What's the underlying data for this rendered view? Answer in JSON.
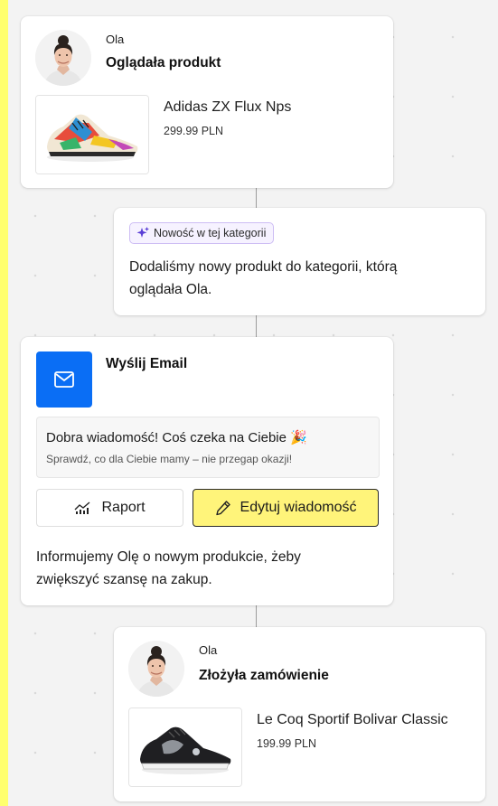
{
  "timeline": {
    "viewed": {
      "user_name": "Ola",
      "action": "Oglądała produkt",
      "product_name": "Adidas ZX Flux Nps",
      "product_price": "299.99 PLN",
      "avatar_icon": "avatar-woman",
      "product_icon": "sneaker-colorful"
    },
    "new_in_category": {
      "badge_icon": "sparkle-icon",
      "badge_label": "Nowość w tej kategorii",
      "text_line1": "Dodaliśmy nowy produkt do kategorii, którą",
      "text_line2": "oglądała Ola."
    },
    "email": {
      "icon": "envelope-icon",
      "title": "Wyślij Email",
      "preview_subject": "Dobra wiadomość! Coś czeka na Ciebie 🎉",
      "preview_body": "Sprawdź, co dla Ciebie mamy – nie przegap okazji!",
      "report_label": "Raport",
      "report_icon": "chart-icon",
      "edit_label": "Edytuj wiadomość",
      "edit_icon": "pencil-icon",
      "description_line1": "Informujemy Olę o nowym produkcie, żeby",
      "description_line2": "zwiększyć szansę na zakup.",
      "accent_color": "#0a6ef5",
      "edit_button_color": "#fff47a"
    },
    "ordered": {
      "user_name": "Ola",
      "action": "Złożyła zamówienie",
      "product_name": "Le Coq Sportif Bolivar Classic",
      "product_price": "199.99 PLN",
      "avatar_icon": "avatar-woman",
      "product_icon": "sneaker-black"
    }
  },
  "colors": {
    "frame": "#ffff6e",
    "canvas": "#f3f3f3",
    "badge_border": "#cdbdf4"
  }
}
